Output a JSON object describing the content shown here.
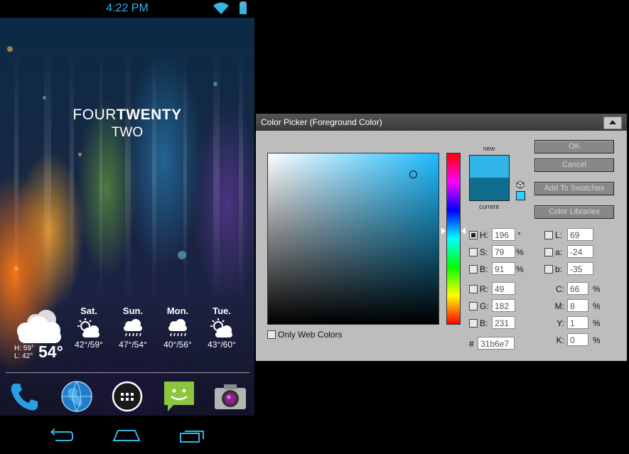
{
  "phone": {
    "status_bar": {
      "time": "4:22 PM",
      "battery_level": "87"
    },
    "clock_widget": {
      "line1_light": "FOUR",
      "line1_bold": "TWENTY",
      "line2": "TWO"
    },
    "weather": {
      "today": {
        "high": "H: 59°",
        "low": "L: 42°",
        "current": "54°",
        "icon": "cloudy-icon"
      },
      "forecast": [
        {
          "day": "Sat.",
          "temps": "42°/59°",
          "icon": "partly-cloudy-icon"
        },
        {
          "day": "Sun.",
          "temps": "47°/54°",
          "icon": "rain-icon"
        },
        {
          "day": "Mon.",
          "temps": "40°/56°",
          "icon": "rain-icon"
        },
        {
          "day": "Tue.",
          "temps": "43°/60°",
          "icon": "partly-cloudy-icon"
        }
      ]
    },
    "dock": [
      "phone-app-icon",
      "browser-app-icon",
      "app-drawer-icon",
      "messaging-app-icon",
      "camera-app-icon"
    ],
    "nav": [
      "back-icon",
      "home-icon",
      "recent-apps-icon"
    ]
  },
  "color_picker": {
    "title": "Color Picker (Foreground Color)",
    "new_label": "new",
    "current_label": "current",
    "new_color": "#31b6e7",
    "current_color": "#0f6e8e",
    "buttons": {
      "ok": "OK",
      "cancel": "Cancel",
      "add_to_swatches": "Add To Swatches",
      "color_libraries": "Color Libraries"
    },
    "fields": {
      "h": {
        "label": "H:",
        "value": "196",
        "unit": "°"
      },
      "s": {
        "label": "S:",
        "value": "79",
        "unit": "%"
      },
      "b": {
        "label": "B:",
        "value": "91",
        "unit": "%"
      },
      "r": {
        "label": "R:",
        "value": "49"
      },
      "g": {
        "label": "G:",
        "value": "182"
      },
      "b_rgb": {
        "label": "B:",
        "value": "231"
      },
      "l": {
        "label": "L:",
        "value": "69"
      },
      "a": {
        "label": "a:",
        "value": "-24"
      },
      "b_lab": {
        "label": "b:",
        "value": "-35"
      },
      "c": {
        "label": "C:",
        "value": "66",
        "unit": "%"
      },
      "m": {
        "label": "M:",
        "value": "8",
        "unit": "%"
      },
      "y": {
        "label": "Y:",
        "value": "1",
        "unit": "%"
      },
      "k": {
        "label": "K:",
        "value": "0",
        "unit": "%"
      }
    },
    "hex_hash": "#",
    "hex": "31b6e7",
    "only_web_colors_label": "Only Web Colors",
    "only_web_colors_checked": false
  }
}
